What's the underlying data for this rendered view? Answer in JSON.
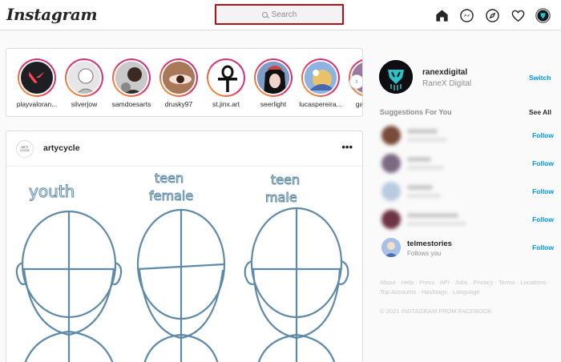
{
  "header": {
    "logo": "Instagram",
    "search_placeholder": "Search"
  },
  "stories": [
    {
      "username": "playvaloran..."
    },
    {
      "username": "silverjow"
    },
    {
      "username": "samdoesarts"
    },
    {
      "username": "drusky97"
    },
    {
      "username": "st.jinx.art"
    },
    {
      "username": "seerlight"
    },
    {
      "username": "lucaspereira..."
    },
    {
      "username": "gacha..."
    }
  ],
  "post": {
    "avatar_text": "ARTY CYCLE",
    "username": "artycycle",
    "more": "•••",
    "image_labels": [
      "youth",
      "teen female",
      "teen male"
    ]
  },
  "sidebar": {
    "username": "ranexdigital",
    "full_name": "RaneX Digital",
    "switch": "Switch",
    "suggestions_title": "Suggestions For You",
    "see_all": "See All",
    "follow_label": "Follow",
    "visible_suggestion": {
      "username": "telmestories",
      "subtitle": "Follows you"
    },
    "footer_links": "About · Help · Press · API · Jobs · Privacy · Terms · Locations · Top Accounts · Hashtags · Language",
    "copyright": "© 2021 INSTAGRAM FROM FACEBOOK"
  },
  "colors": {
    "accent_blue": "#0095f6",
    "search_highlight": "#b10f1a"
  }
}
